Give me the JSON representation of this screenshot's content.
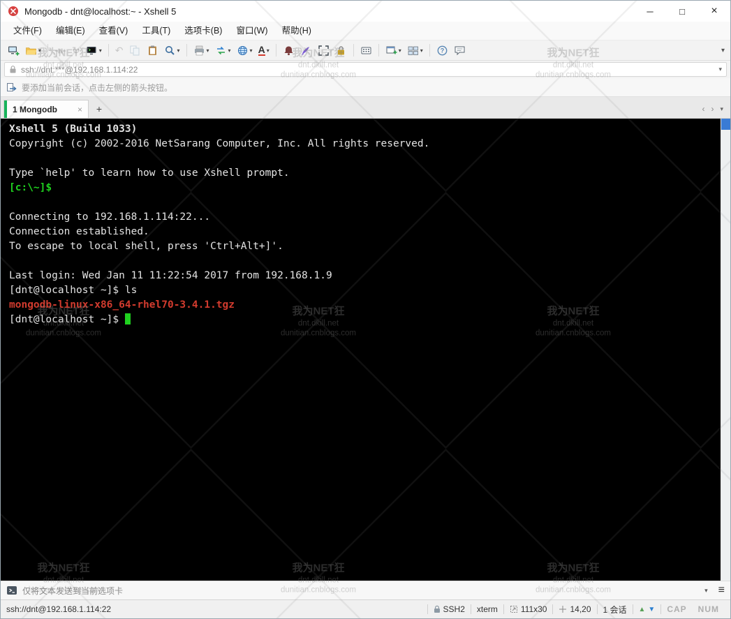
{
  "window": {
    "title": "Mongodb - dnt@localhost:~ - Xshell 5",
    "controls": {
      "minimize": "─",
      "maximize": "□",
      "close": "×"
    }
  },
  "menu": {
    "items": [
      "文件(F)",
      "编辑(E)",
      "查看(V)",
      "工具(T)",
      "选项卡(B)",
      "窗口(W)",
      "帮助(H)"
    ]
  },
  "icons": {
    "caret_down": "▾",
    "chevron_left": "‹",
    "chevron_right": "›",
    "hamburger": "≡",
    "undo": "↶",
    "reconnect": "↻",
    "font": "A",
    "roll_up": "▲",
    "roll_down": "▼"
  },
  "address_bar": {
    "value": "ssh://dnt:***@192.168.1.114:22"
  },
  "hint_bar": {
    "text": "要添加当前会话，点击左侧的箭头按钮。"
  },
  "tab_bar": {
    "active_tab": "1 Mongodb",
    "close": "×",
    "new_tab": "+"
  },
  "terminal": {
    "colors": {
      "background": "#000000",
      "foreground": "#e4e4e4",
      "green": "#1fd11f",
      "red": "#d23b2e"
    },
    "lines": [
      {
        "text": "Xshell 5 (Build 1033)",
        "bold": true
      },
      {
        "text": "Copyright (c) 2002-2016 NetSarang Computer, Inc. All rights reserved."
      },
      {
        "text": ""
      },
      {
        "text": "Type `help' to learn how to use Xshell prompt."
      },
      {
        "text": "[c:\\~]$",
        "color": "green",
        "bold": true
      },
      {
        "text": ""
      },
      {
        "text": "Connecting to 192.168.1.114:22..."
      },
      {
        "text": "Connection established."
      },
      {
        "text": "To escape to local shell, press 'Ctrl+Alt+]'."
      },
      {
        "text": ""
      },
      {
        "text": "Last login: Wed Jan 11 11:22:54 2017 from 192.168.1.9"
      },
      {
        "text": "[dnt@localhost ~]$ ls"
      },
      {
        "text": "mongodb-linux-x86_64-rhel70-3.4.1.tgz",
        "color": "red",
        "bold": true
      },
      {
        "text": "[dnt@localhost ~]$ ",
        "cursor": true
      }
    ]
  },
  "watermark": {
    "lines": [
      "我为NET狂",
      "dnt.dkill.net",
      "dunitian.cnblogs.com"
    ]
  },
  "send_bar": {
    "text": "仅将文本发送到当前选项卡"
  },
  "status_bar": {
    "connection": "ssh://dnt@192.168.1.114:22",
    "protocol": "SSH2",
    "terminal_type": "xterm",
    "size": "111x30",
    "cursor_position": "14,20",
    "sessions": "1 会话",
    "caps": "CAP",
    "num": "NUM"
  }
}
